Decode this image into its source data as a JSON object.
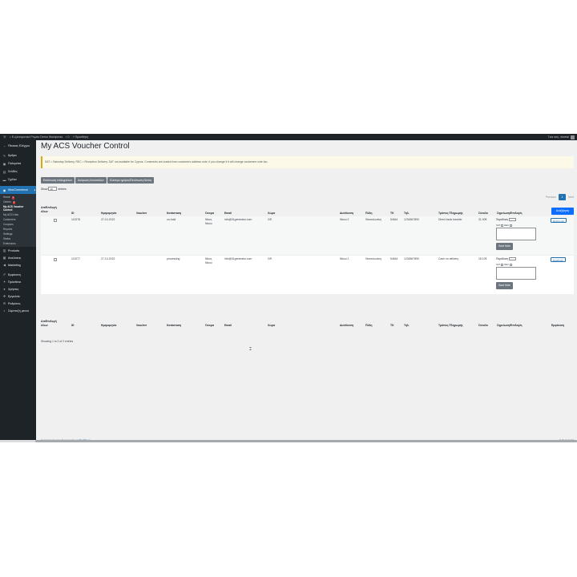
{
  "admin_bar": {
    "site_name": "Ε-ηλεκτρονικό Ρόμπο Demo Wordpress",
    "comments_count": "0",
    "new_label": "Προσθήκη",
    "user_greeting": "Γεια σας, eiwewi"
  },
  "sidebar": {
    "items": [
      {
        "label": "Πίνακας Ελέγχου",
        "icon": "dashboard-icon"
      },
      {
        "label": "Άρθρα",
        "icon": "pin-icon"
      },
      {
        "label": "Πολυμέσα",
        "icon": "media-icon"
      },
      {
        "label": "Σελίδες",
        "icon": "page-icon"
      },
      {
        "label": "Σχόλια",
        "icon": "comment-icon"
      }
    ],
    "woocommerce_label": "WooCommerce",
    "woo_sub": {
      "home": "Home",
      "home_badge": "1",
      "orders": "Orders",
      "orders_badge": "2",
      "current": "My ACS Voucher Control",
      "list": "My ACS Lists",
      "customers": "Customers",
      "coupons": "Coupons",
      "reports": "Reports",
      "settings": "Settings",
      "status": "Status",
      "extensions": "Extensions"
    },
    "bottom_items": [
      {
        "label": "Products",
        "icon": "box-icon"
      },
      {
        "label": "Αναλύσεις",
        "icon": "chart-icon"
      },
      {
        "label": "Marketing",
        "icon": "megaphone-icon"
      },
      {
        "label": "Εμφάνιση",
        "icon": "brush-icon"
      },
      {
        "label": "Πρόσθετα",
        "icon": "plugin-icon"
      },
      {
        "label": "Χρήστες",
        "icon": "user-icon"
      },
      {
        "label": "Εργαλεία",
        "icon": "wrench-icon"
      },
      {
        "label": "Ρυθμίσεις",
        "icon": "settings-icon"
      },
      {
        "label": "Σύμπτυξη μενού",
        "icon": "collapse-icon"
      }
    ]
  },
  "page": {
    "title": "My ACS Voucher Control",
    "notice": "SAT = Saturday Delivery, REC = Reception Delivery. SAT not available for Cyprus. Comments are loaded from customers address note, if you change it it will change customers note too.",
    "buttons": [
      "Εκτύπωση επιλεγμένων",
      "Ακύρωση Αποστολών",
      "Κλείσιμο ημέρας/Εκτύπωση Λίστας"
    ],
    "show_label": "Show",
    "show_value": "10",
    "entries_label": "entries",
    "pager": {
      "previous": "Previous",
      "current": "1",
      "next": "Next"
    }
  },
  "table": {
    "headers": {
      "select": "Απ/Επιλογή όλων",
      "id": "ID",
      "date": "Ημερομηνία",
      "voucher": "Voucher",
      "status": "Κατάσταση",
      "name": "Όνομα",
      "email": "Email",
      "country": "Χώρα",
      "address": "Διεύθυνση",
      "city": "Πόλη",
      "zip": "ΤΚ",
      "phone": "Τηλ.",
      "payment": "Τρόπος Πληρωμής",
      "total": "Σύνολο",
      "notes": "Σημείωση/Επιλογές",
      "print": "Εμφάνιση"
    },
    "filters": {
      "sort_marker": "▴",
      "id_placeholder": "#",
      "date_from_placeholder": "από",
      "date_to_placeholder": "Μέχρι",
      "voucher_placeholder": "Voucher for",
      "status_value": "Όλα",
      "email_placeholder": "Email",
      "country_value": "Όλα",
      "phone_placeholder": "Τηλ.",
      "payment_value": "Όλα",
      "search_button": "Αναζήτηση"
    },
    "rows": [
      {
        "id": "113278",
        "date": "27-10-2022",
        "voucher": "",
        "status": "on-hold",
        "name_first": "Νίκος",
        "name_last": "Νίκου",
        "email": "info@01generator.com",
        "country": "GR",
        "address": "Νίκου 2",
        "city": "Θεσσαλονίκη",
        "zip": "54644",
        "phone": "1234567890",
        "payment": "Direct bank transfer",
        "total": "31.00€",
        "note_select": "Παράδοση",
        "sat_label": "SAT",
        "rec_label": "REC",
        "save_note": "Save Note",
        "print_label": "Εκτύπωση"
      },
      {
        "id": "113277",
        "date": "27-10-2022",
        "voucher": "",
        "status": "processing",
        "name_first": "Νίκος",
        "name_last": "Νίκου",
        "email": "info@01generator.com",
        "country": "GR",
        "address": "Νίκου 2",
        "city": "Θεσσαλονίκη",
        "zip": "54644",
        "phone": "1234567890",
        "payment": "Cash on delivery",
        "total": "18.12€",
        "note_select": "Παράδοση",
        "sat_label": "SAT",
        "rec_label": "REC",
        "save_note": "Save Note",
        "print_label": "Εμφάνιση"
      }
    ],
    "info": "Showing 1 to 2 of 2 entries"
  },
  "footer": {
    "thanks": "Ευχαριστούμε που δημιουργείτε με",
    "link": "WordPress.",
    "version": "Έκδοση 6.0.3"
  },
  "colors": {
    "admin_dark": "#1d2327",
    "accent_blue": "#2271b1",
    "primary_btn": "#0d6efd",
    "secondary_btn": "#6c757d",
    "notice_bg": "#fcf9e8",
    "badge_red": "#d63638"
  }
}
